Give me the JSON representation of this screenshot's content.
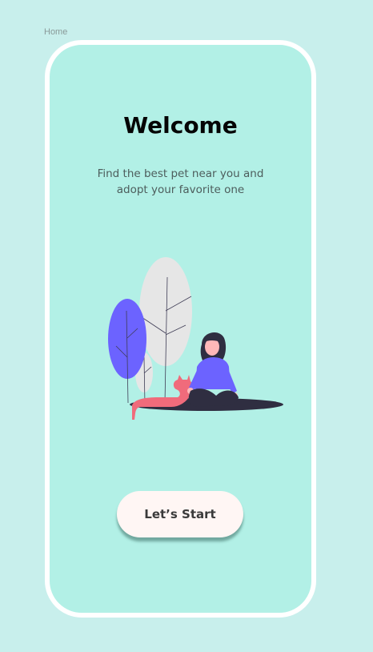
{
  "frame": {
    "label": "Home"
  },
  "screen": {
    "title": "Welcome",
    "subtitle": "Find the best pet near you and adopt your favorite one",
    "illustration": "woman-sitting-with-cat-illustration",
    "cta_label": "Let’s Start"
  },
  "colors": {
    "canvas": "#c8efec",
    "screen_background": "#b2f0e6",
    "screen_border": "#ffffff",
    "button_background": "#fff6f4",
    "accent_purple": "#6c63ff",
    "cat_pink": "#f06b7b"
  }
}
